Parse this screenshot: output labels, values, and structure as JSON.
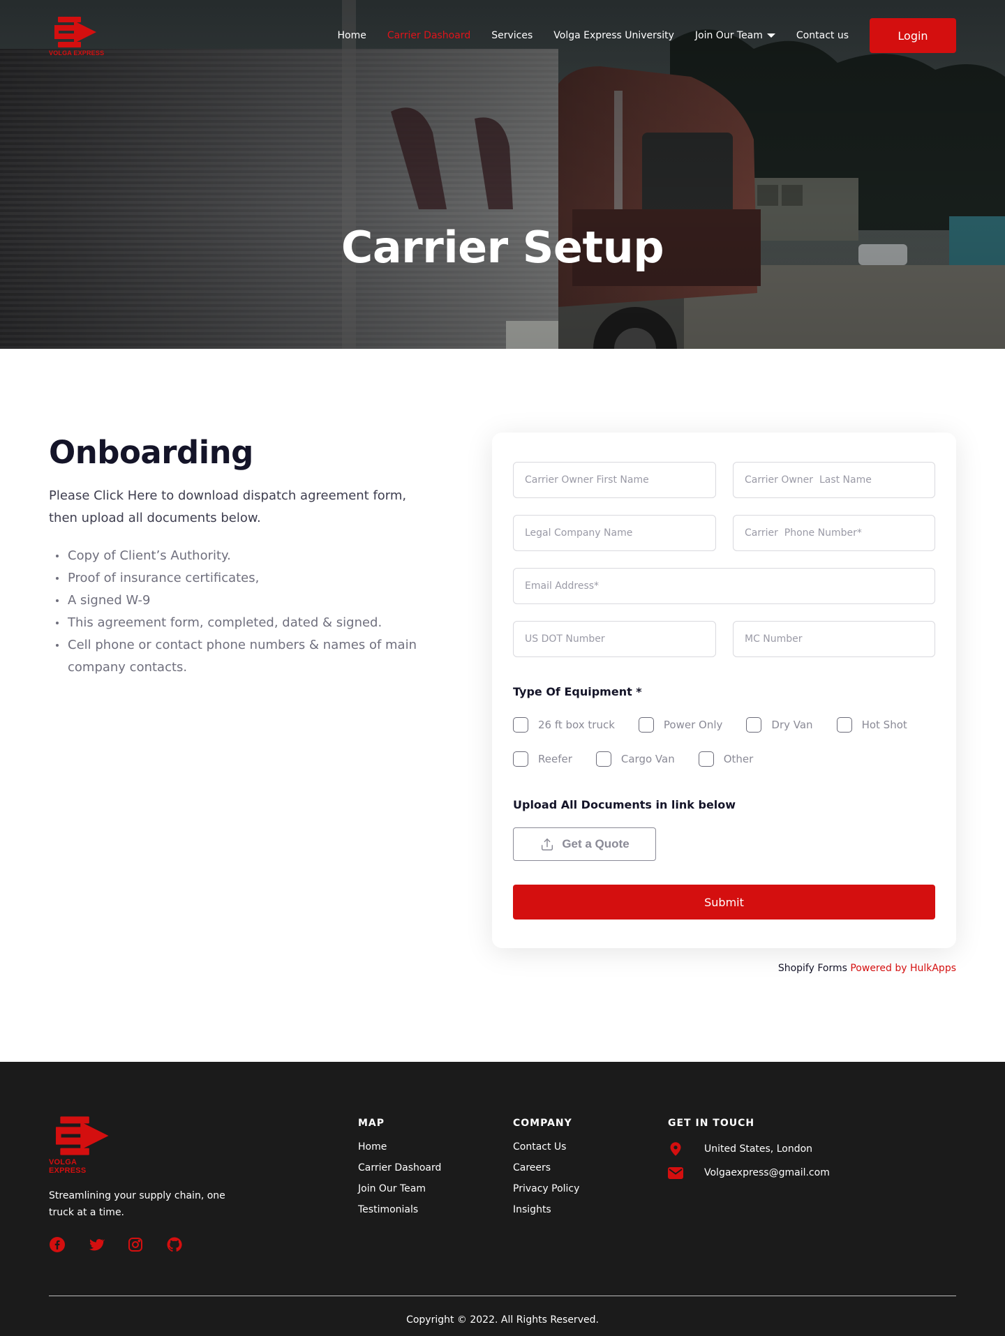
{
  "colors": {
    "accent": "#d40f0f",
    "footer_bg": "#1b1b1b",
    "heading": "#141428"
  },
  "brand": {
    "name": "VOLGA EXPRESS",
    "logo_icon": "arrow-logo-icon"
  },
  "nav": {
    "items": [
      {
        "label": "Home",
        "active": false
      },
      {
        "label": "Carrier Dashoard",
        "active": true
      },
      {
        "label": "Services",
        "active": false
      },
      {
        "label": "Volga Express University",
        "active": false
      },
      {
        "label": "Join Our Team",
        "active": false,
        "dropdown": true
      },
      {
        "label": "Contact us",
        "active": false
      }
    ],
    "login_label": "Login"
  },
  "hero": {
    "title": "Carrier Setup"
  },
  "onboarding": {
    "title": "Onboarding",
    "intro": "Please Click Here to download dispatch agreement form, then upload all documents below.",
    "documents": [
      "Copy of Client’s Authority.",
      "Proof of insurance certificates,",
      "A signed W-9",
      "This agreement form, completed, dated & signed.",
      "Cell phone or contact phone numbers & names of main company contacts."
    ]
  },
  "form": {
    "placeholders": {
      "first_name": "Carrier Owner First Name",
      "last_name": "Carrier Owner  Last Name",
      "company": "Legal Company Name",
      "phone": "Carrier  Phone Number*",
      "email": "Email Address*",
      "dot": "US DOT Number",
      "mc": "MC Number"
    },
    "equipment_label": "Type Of Equipment *",
    "equipment_row1": [
      "26 ft box truck",
      "Power Only",
      "Dry Van",
      "Hot Shot"
    ],
    "equipment_row2": [
      "Reefer",
      "Cargo Van",
      "Other"
    ],
    "upload_label": "Upload All Documents in link below",
    "upload_button": "Get a Quote",
    "submit_label": "Submit"
  },
  "powered": {
    "prefix": "Shopify Forms",
    "link": "Powered by HulkApps"
  },
  "footer": {
    "tagline": "Streamlining your supply chain, one truck at a time.",
    "social_icons": [
      "facebook-icon",
      "twitter-icon",
      "instagram-icon",
      "github-icon"
    ],
    "map": {
      "heading": "MAP",
      "links": [
        "Home",
        "Carrier Dashoard",
        "Join Our Team",
        "Testimonials"
      ]
    },
    "company": {
      "heading": "COMPANY",
      "links": [
        "Contact Us",
        "Careers",
        "Privacy Policy",
        "Insights"
      ]
    },
    "contact": {
      "heading": "GET IN TOUCH",
      "location": "United States, London",
      "email": "Volgaexpress@gmail.com"
    },
    "copyright": "Copyright © 2022. All Rights Reserved."
  }
}
